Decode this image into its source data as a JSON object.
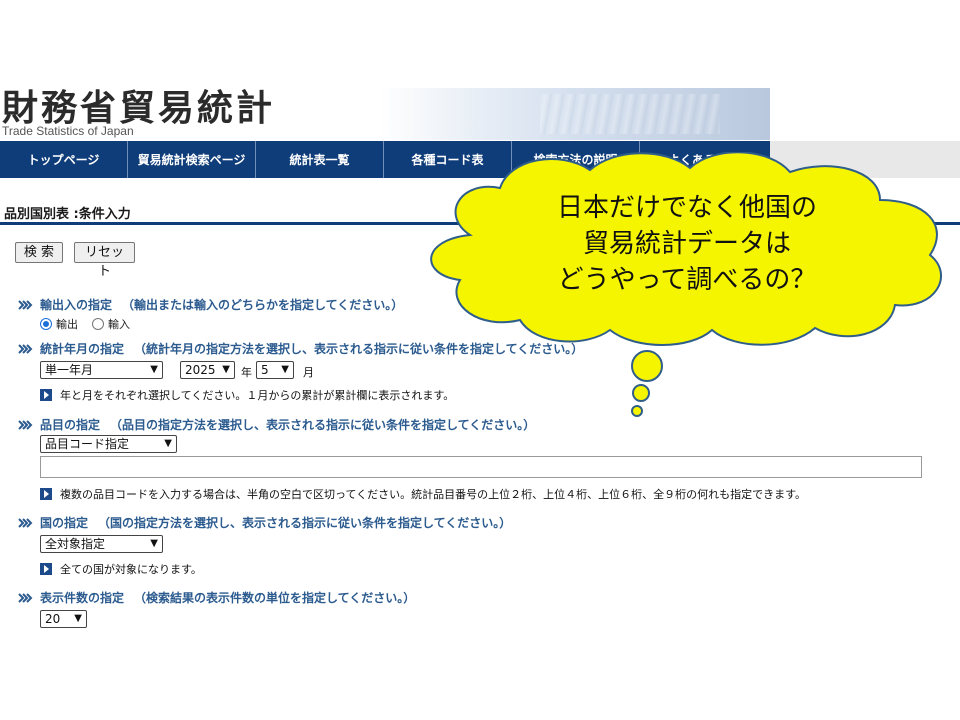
{
  "header": {
    "title": "財務省貿易統計",
    "subtitle": "Trade Statistics of Japan"
  },
  "nav": {
    "items": [
      "トップページ",
      "貿易統計検索ページ",
      "統計表一覧",
      "各種コード表",
      "検索方法の説明",
      "よくある質問"
    ]
  },
  "page": {
    "title": "品別国別表 :条件入力",
    "search_button": "検 索",
    "reset_button": "リセット"
  },
  "sections": {
    "trade_type": {
      "heading": "輸出入の指定",
      "note": "（輸出または輸入のどちらかを指定してください。）",
      "options": [
        "輸出",
        "輸入"
      ],
      "selected": "輸出"
    },
    "period": {
      "heading": "統計年月の指定",
      "note": "（統計年月の指定方法を選択し、表示される指示に従い条件を指定してください。）",
      "method": "単一年月",
      "year": "2025",
      "year_label": "年",
      "month": "5",
      "month_label": "月",
      "hint": "年と月をそれぞれ選択してください。１月からの累計が累計欄に表示されます。"
    },
    "commodity": {
      "heading": "品目の指定",
      "note": "（品目の指定方法を選択し、表示される指示に従い条件を指定してください。）",
      "method": "品目コード指定",
      "input_value": "",
      "hint": "複数の品目コードを入力する場合は、半角の空白で区切ってください。統計品目番号の上位２桁、上位４桁、上位６桁、全９桁の何れも指定できます。"
    },
    "country": {
      "heading": "国の指定",
      "note": "（国の指定方法を選択し、表示される指示に従い条件を指定してください。）",
      "method": "全対象指定",
      "hint": "全ての国が対象になります。"
    },
    "display": {
      "heading": "表示件数の指定",
      "note": "（検索結果の表示件数の単位を指定してください。）",
      "count": "20"
    }
  },
  "callout": {
    "lines": [
      "日本だけでなく他国の",
      "貿易統計データは",
      "どうやって調べるの？"
    ],
    "fill_color": "#f5f500",
    "stroke_color": "#2f5e8a"
  },
  "colors": {
    "nav_bg": "#0f3d7a",
    "section_heading": "#2c5b8f"
  }
}
